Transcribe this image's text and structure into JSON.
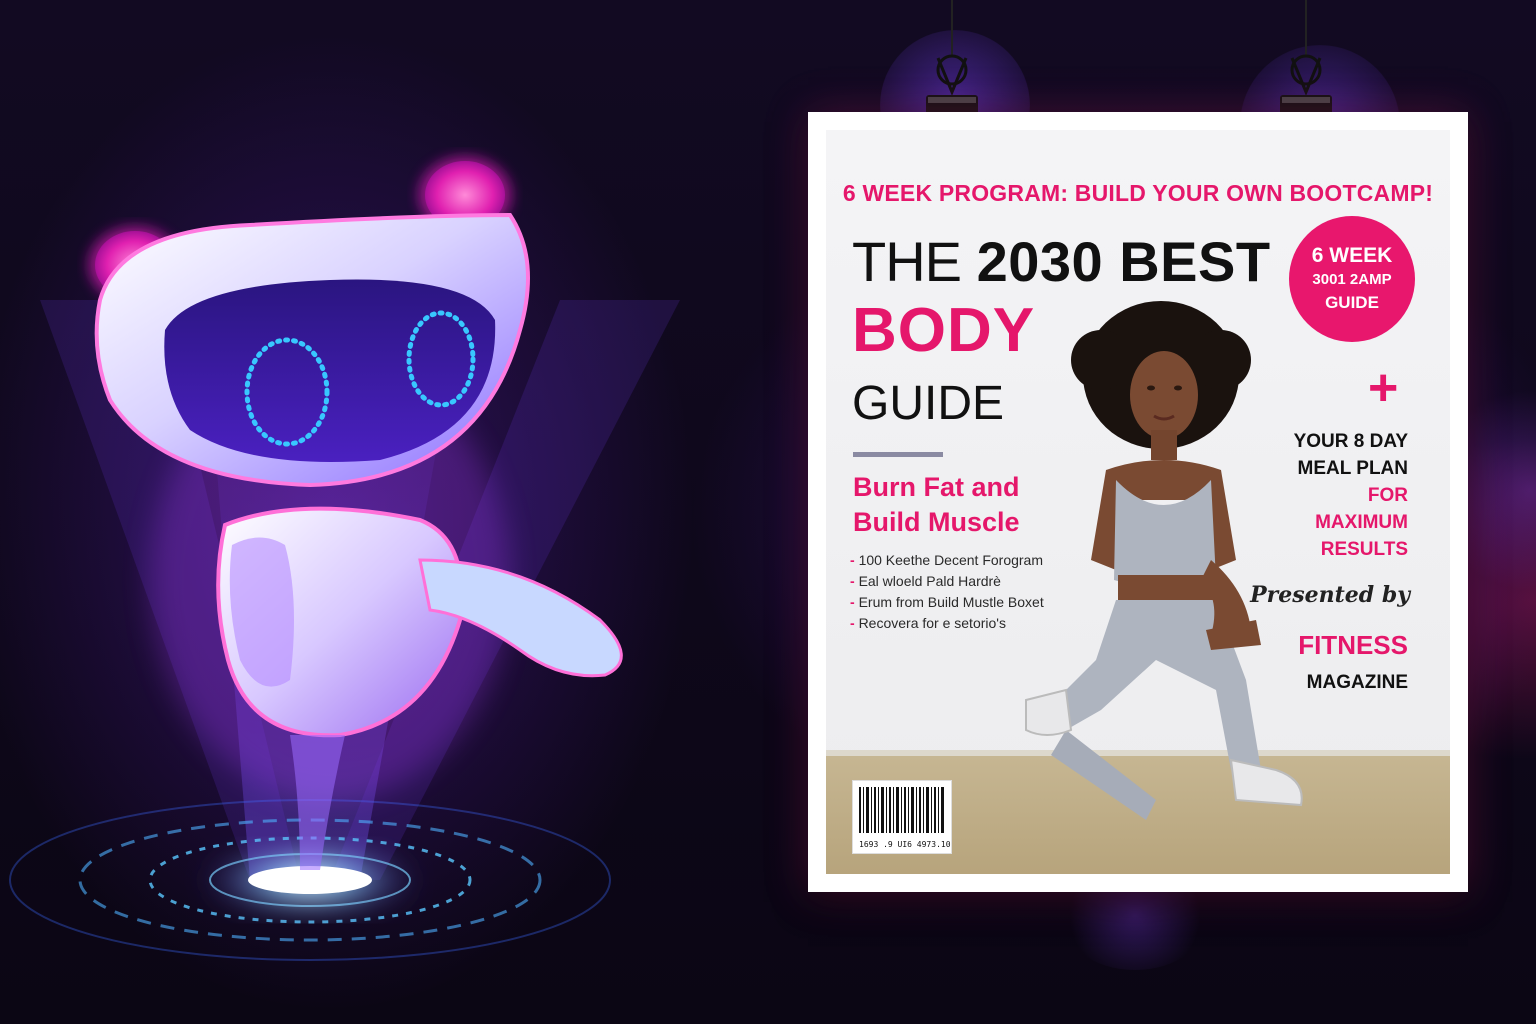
{
  "scene": {
    "background": "#0d0716",
    "accent_pink": "#e5176b",
    "accent_purple": "#7a3cf0"
  },
  "robot": {
    "icon": "hologram-robot-mascot-icon"
  },
  "magazine_cover": {
    "top_banner": "6 WEEK PROGRAM: BUILD YOUR OWN BOOTCAMP!",
    "title": {
      "the": "THE",
      "year_best": "2030 BEST",
      "body": "BODY",
      "guide": "GUIDE"
    },
    "sub_headline": "Burn Fat and Build Muscle",
    "bullets": [
      "100 Keethe Decent Forogram",
      "Eal wloeld Pald Hardrè",
      "Erum from Build Mustle Boxet",
      "Recovera for e setorio's"
    ],
    "badge": {
      "line1": "6 WEEK",
      "line2": "3001 2AMP",
      "line3": "GUIDE"
    },
    "plus_symbol": "+",
    "meal_plan": {
      "line1": "YOUR 8 DAY",
      "line2": "MEAL PLAN",
      "line3": "FOR",
      "line4": "MAXIMUM",
      "line5": "RESULTS"
    },
    "presented_by": "Presented by",
    "publisher_top": "FITNESS",
    "publisher_bottom": "MAGAZINE",
    "barcode_text": "1693 .9 UI6 4973.10"
  }
}
